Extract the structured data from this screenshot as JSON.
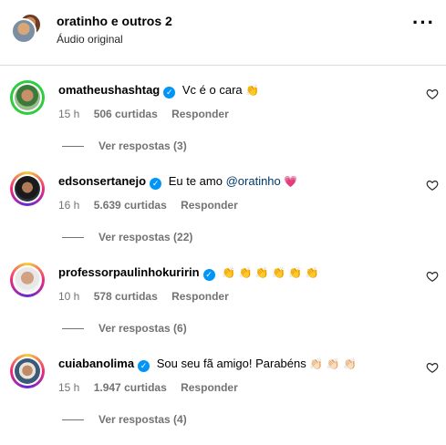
{
  "header": {
    "title": "oratinho e outros 2",
    "subtitle": "Áudio original",
    "more_icon": "more-horizontal-icon"
  },
  "comments": [
    {
      "username": "omatheushashtag",
      "text": "Vc é o cara",
      "emoji": "👏",
      "time": "15 h",
      "likes": "506 curtidas",
      "reply": "Responder",
      "view_replies": "Ver respostas (3)",
      "ring": "green"
    },
    {
      "username": "edsonsertanejo",
      "text": "Eu te amo ",
      "mention": "@oratinho",
      "emoji": "💗",
      "time": "16 h",
      "likes": "5.639 curtidas",
      "reply": "Responder",
      "view_replies": "Ver respostas (22)",
      "ring": "gradient"
    },
    {
      "username": "professorpaulinhokuririn",
      "text": "",
      "emoji": "👏 👏 👏 👏 👏 👏",
      "time": "10 h",
      "likes": "578 curtidas",
      "reply": "Responder",
      "view_replies": "Ver respostas (6)",
      "ring": "gradient"
    },
    {
      "username": "cuiabanolima",
      "text": "Sou seu fã amigo! Parabéns",
      "emoji": "👏🏻 👏🏻 👏🏻",
      "time": "15 h",
      "likes": "1.947 curtidas",
      "reply": "Responder",
      "view_replies": "Ver respostas (4)",
      "ring": "gradient"
    }
  ],
  "colors": {
    "verified": "#0095f6",
    "mention": "#00376b",
    "muted": "#737373"
  }
}
